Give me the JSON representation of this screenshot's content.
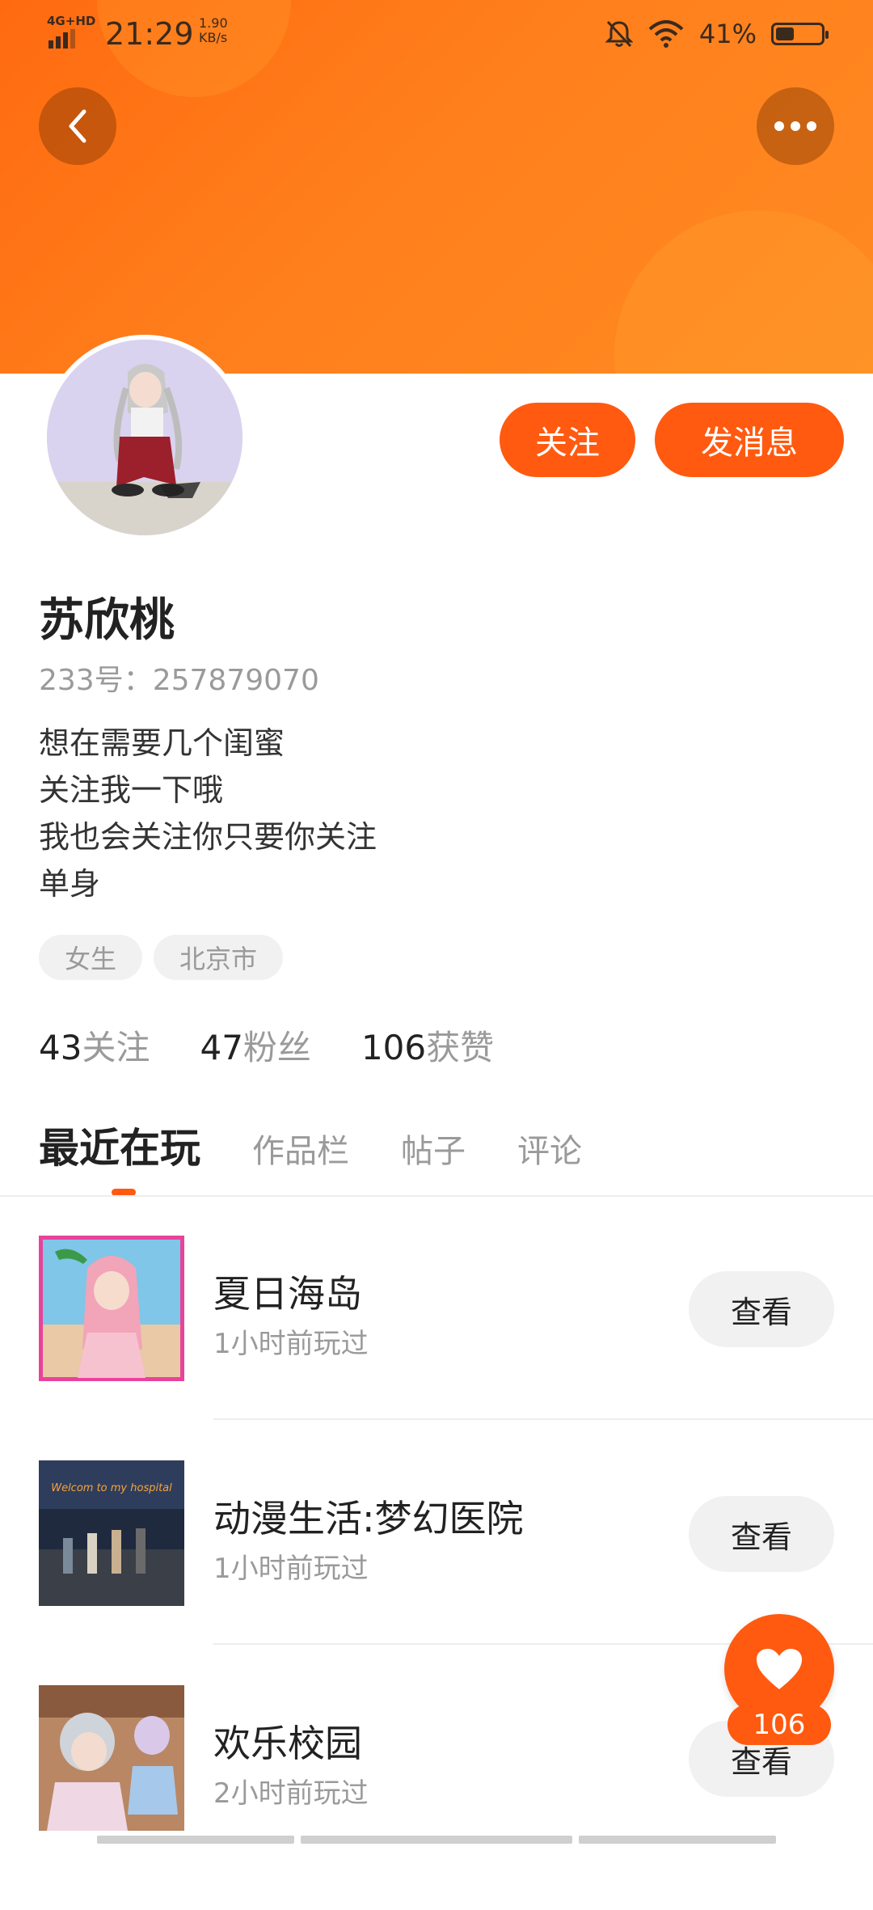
{
  "status_bar": {
    "network": "4G+HD",
    "time": "21:29",
    "speed_value": "1.90",
    "speed_unit": "KB/s",
    "battery_percent": "41%",
    "battery_level": 0.41,
    "icons": [
      "signal-bars-icon",
      "bell-off-icon",
      "wifi-icon",
      "battery-icon"
    ]
  },
  "header": {
    "back_icon": "chevron-left-icon",
    "more_icon": "more-dots-icon",
    "banner_color": "#ff7a1a"
  },
  "profile": {
    "name": "苏欣桃",
    "id_line": "233号：257879070",
    "bio": [
      "想在需要几个闺蜜",
      "关注我一下哦",
      "我也会关注你只要你关注",
      "单身"
    ],
    "tags": [
      "女生",
      "北京市"
    ],
    "stats": [
      {
        "num": "43",
        "label": "关注"
      },
      {
        "num": "47",
        "label": "粉丝"
      },
      {
        "num": "106",
        "label": "获赞"
      }
    ]
  },
  "actions": {
    "follow_label": "关注",
    "message_label": "发消息",
    "accent_color": "#ff5a10"
  },
  "tabs": [
    {
      "label": "最近在玩",
      "active": true
    },
    {
      "label": "作品栏",
      "active": false
    },
    {
      "label": "帖子",
      "active": false
    },
    {
      "label": "评论",
      "active": false
    }
  ],
  "games": [
    {
      "title": "夏日海岛",
      "subtitle": "1小时前玩过",
      "button": "查看"
    },
    {
      "title": "动漫生活:梦幻医院",
      "subtitle": "1小时前玩过",
      "button": "查看",
      "thumb_text": "Welcom to my hospital"
    },
    {
      "title": "欢乐校园",
      "subtitle": "2小时前玩过",
      "button": "查看"
    }
  ],
  "floating_like": {
    "icon": "heart-icon",
    "count": "106"
  }
}
